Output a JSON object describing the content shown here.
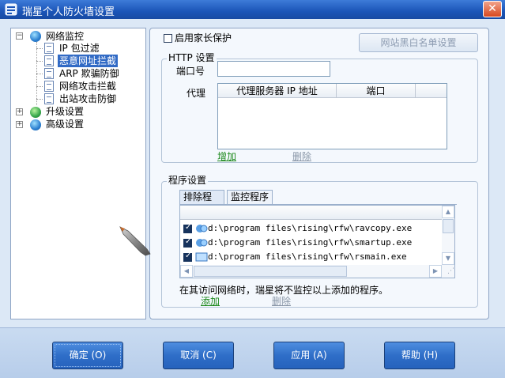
{
  "window": {
    "title": "瑞星个人防火墙设置"
  },
  "tree": {
    "root": "网络监控",
    "children": [
      "IP 包过滤",
      "恶意网址拦截",
      "ARP 欺骗防御",
      "网络攻击拦截",
      "出站攻击防御"
    ],
    "others": [
      "升级设置",
      "高级设置"
    ]
  },
  "parental": {
    "label": "启用家长保护",
    "whitelist_button": "网站黑白名单设置"
  },
  "http": {
    "legend": "HTTP 设置",
    "port_label": "端口号",
    "port_value": "",
    "proxy_label": "代理",
    "columns": [
      "代理服务器 IP 地址",
      "端口"
    ],
    "add": "增加",
    "delete": "删除"
  },
  "program": {
    "legend": "程序设置",
    "tabs": [
      "排除程序",
      "监控程序"
    ],
    "rows": [
      "d:\\program files\\rising\\rfw\\ravcopy.exe",
      "d:\\program files\\rising\\rfw\\smartup.exe",
      "d:\\program files\\rising\\rfw\\rsmain.exe"
    ],
    "note": "在其访问网络时，瑞星将不监控以上添加的程序。",
    "add": "添加",
    "delete": "删除"
  },
  "buttons": {
    "ok": "确定 (O)",
    "cancel": "取消 (C)",
    "apply": "应用 (A)",
    "help": "帮助 (H)"
  },
  "colors": {
    "title_bar": "#1b55b8",
    "selection": "#316ac5",
    "link_active": "#1f8a1f",
    "button": "#2f6ec8"
  },
  "icons": [
    "shield-icon",
    "globe-icon",
    "document-icon",
    "expand-icon",
    "collapse-icon",
    "checkbox-icon",
    "bullet-cursor-icon"
  ]
}
